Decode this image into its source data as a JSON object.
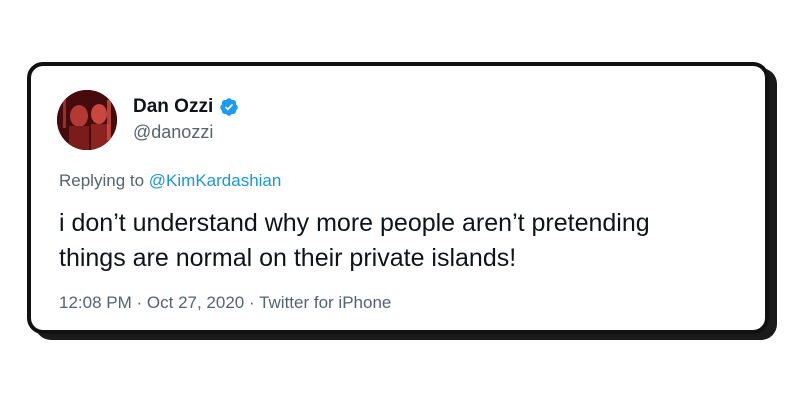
{
  "tweet": {
    "author": {
      "name": "Dan Ozzi",
      "handle": "@danozzi",
      "verified": true
    },
    "reply": {
      "prefix": "Replying to",
      "mention": "@KimKardashian"
    },
    "text_line1": "i don’t understand why more people aren’t pretending",
    "text_line2": "things are normal on their private islands!",
    "time": "12:08 PM",
    "separator1": "·",
    "date": "Oct 27, 2020",
    "separator2": "·",
    "source": "Twitter for iPhone"
  },
  "colors": {
    "verified": "#1d9bf0",
    "mention": "#1b95e0",
    "secondary_text": "#536471",
    "primary_text": "#0f1419"
  }
}
